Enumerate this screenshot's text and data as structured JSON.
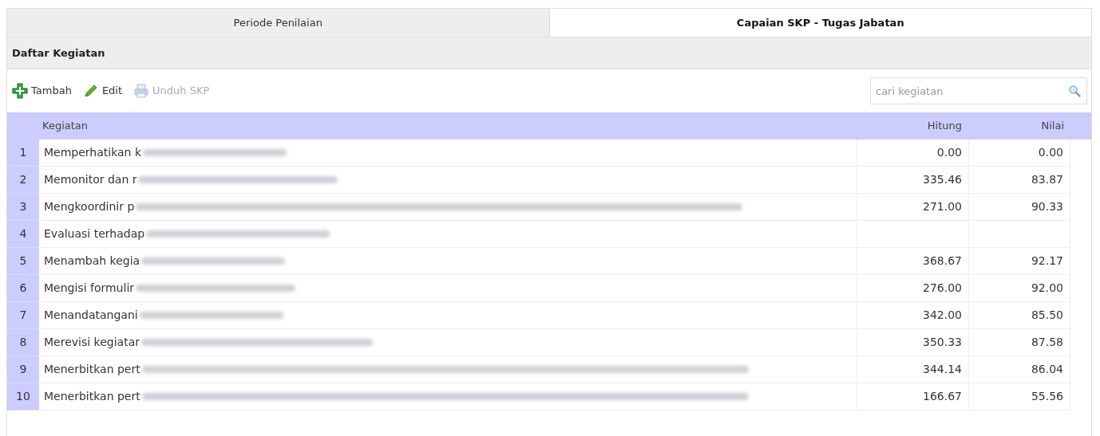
{
  "tabs": [
    {
      "label": "Periode Penilaian",
      "selected": false
    },
    {
      "label": "Capaian SKP - Tugas Jabatan",
      "selected": true
    }
  ],
  "panel": {
    "title": "Daftar Kegiatan"
  },
  "toolbar": [
    {
      "kind": "add",
      "label": "Tambah",
      "disabled": false
    },
    {
      "kind": "edit",
      "label": "Edit",
      "disabled": false
    },
    {
      "kind": "print",
      "label": "Unduh SKP",
      "disabled": true
    }
  ],
  "search": {
    "placeholder": "cari kegiatan"
  },
  "table": {
    "columns": [
      "Kegiatan",
      "Hitung",
      "Nilai"
    ],
    "rows": [
      {
        "no": "1",
        "kegiatan": "Memperhatikan k",
        "redacted": true,
        "hitung": "0.00",
        "nilai": "0.00"
      },
      {
        "no": "2",
        "kegiatan": "Memonitor dan r",
        "redacted": true,
        "hitung": "335.46",
        "nilai": "83.87"
      },
      {
        "no": "3",
        "kegiatan": "Mengkoordinir p",
        "redacted": true,
        "hitung": "271.00",
        "nilai": "90.33"
      },
      {
        "no": "4",
        "kegiatan": "Evaluasi terhadap",
        "redacted": true
      },
      {
        "no": "5",
        "kegiatan": "Menambah kegia",
        "redacted": true,
        "hitung": "368.67",
        "nilai": "92.17"
      },
      {
        "no": "6",
        "kegiatan": "Mengisi formulir",
        "redacted": true,
        "hitung": "276.00",
        "nilai": "92.00"
      },
      {
        "no": "7",
        "kegiatan": "Menandatangani",
        "redacted": true,
        "hitung": "342.00",
        "nilai": "85.50"
      },
      {
        "no": "8",
        "kegiatan": "Merevisi kegiatar",
        "redacted": true,
        "hitung": "350.33",
        "nilai": "87.58"
      },
      {
        "no": "9",
        "kegiatan": "Menerbitkan pert",
        "redacted": true,
        "hitung": "344.14",
        "nilai": "86.04"
      },
      {
        "no": "10",
        "kegiatan": "Menerbitkan pert",
        "redacted": true,
        "hitung": "166.67",
        "nilai": "55.56"
      }
    ]
  }
}
